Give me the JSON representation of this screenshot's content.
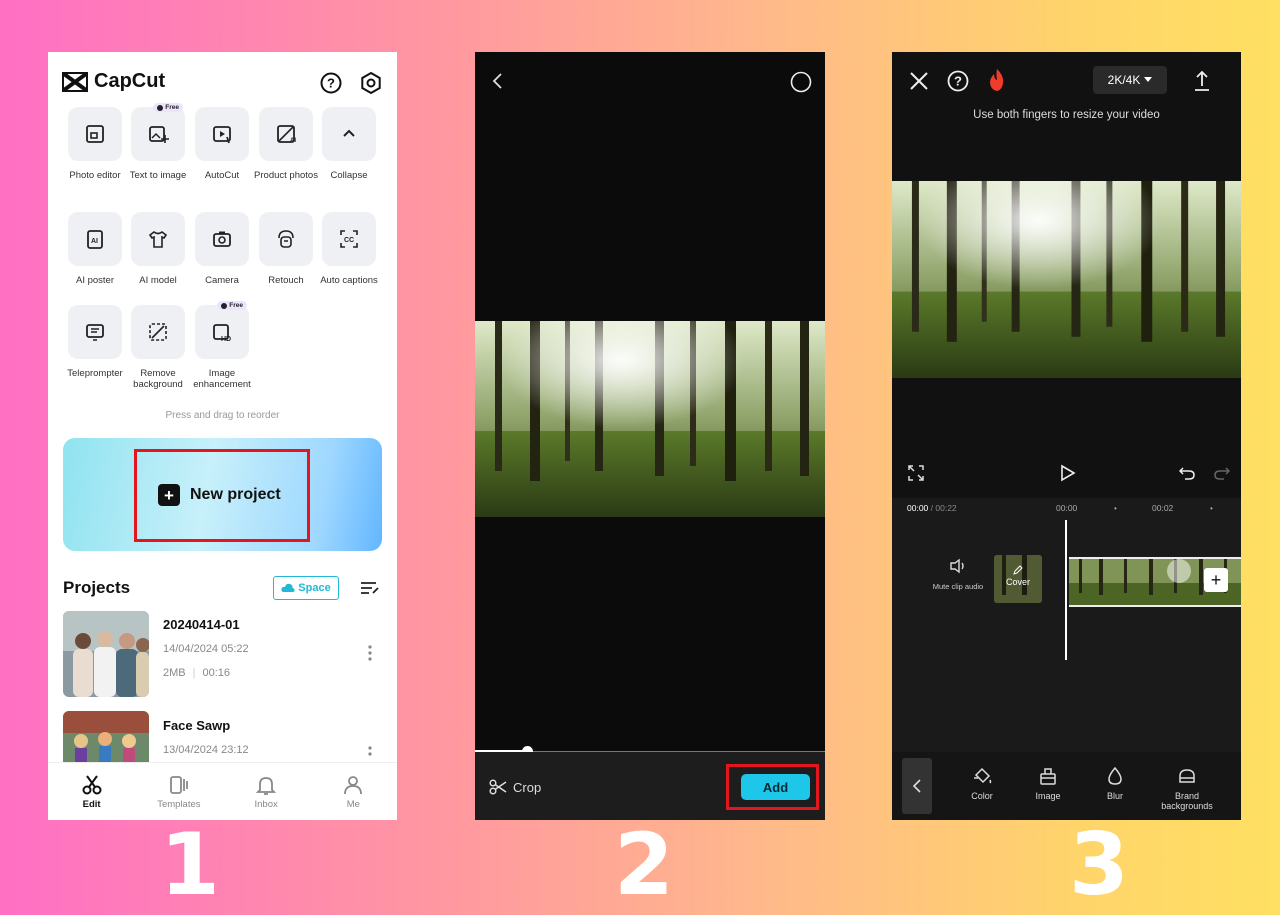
{
  "steps": [
    "1",
    "2",
    "3"
  ],
  "screen1": {
    "brand": "CapCut",
    "tools": [
      {
        "label": "Photo editor"
      },
      {
        "label": "Text to image",
        "badge": "Free"
      },
      {
        "label": "AutoCut"
      },
      {
        "label": "Product photos"
      },
      {
        "label": "Collapse"
      },
      {
        "label": "AI poster"
      },
      {
        "label": "AI model"
      },
      {
        "label": "Camera"
      },
      {
        "label": "Retouch"
      },
      {
        "label": "Auto captions"
      },
      {
        "label": "Teleprompter"
      },
      {
        "label": "Remove background"
      },
      {
        "label": "Image enhancement",
        "badge": "Free"
      }
    ],
    "reorder_hint": "Press and drag to reorder",
    "new_project_label": "New project",
    "projects_title": "Projects",
    "space_label": "Space",
    "projects": [
      {
        "name": "20240414-01",
        "date": "14/04/2024 05:22",
        "size": "2MB",
        "duration": "00:16"
      },
      {
        "name": "Face Sawp",
        "date": "13/04/2024 23:12"
      }
    ],
    "nav": [
      {
        "label": "Edit",
        "active": true
      },
      {
        "label": "Templates"
      },
      {
        "label": "Inbox"
      },
      {
        "label": "Me"
      }
    ],
    "highlight_color": "#e3161d"
  },
  "screen2": {
    "crop_label": "Crop",
    "add_label": "Add",
    "accent": "#1ec7ea",
    "progress_fraction": 0.15
  },
  "screen3": {
    "resolution": "2K/4K",
    "hint": "Use both fingers to resize your video",
    "time_current": "00:00",
    "time_total": "/ 00:22",
    "ruler": [
      "00:00",
      "00:02"
    ],
    "mute_label": "Mute clip audio",
    "cover_label": "Cover",
    "tools": [
      {
        "label": "Color"
      },
      {
        "label": "Image"
      },
      {
        "label": "Blur"
      },
      {
        "label": "Brand backgrounds"
      }
    ]
  }
}
